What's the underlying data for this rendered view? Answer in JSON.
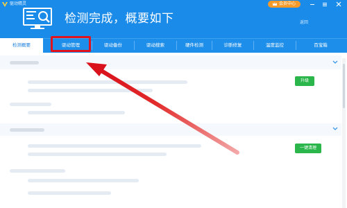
{
  "titlebar": {
    "app_name": "驱动精灵",
    "vip_label": "会员中心"
  },
  "header": {
    "title": "检测完成，概要如下",
    "small_text": "返回"
  },
  "tabs": [
    {
      "label": "检测概要"
    },
    {
      "label": "驱动管理"
    },
    {
      "label": "驱动备份"
    },
    {
      "label": "驱动搜索"
    },
    {
      "label": "硬件检测"
    },
    {
      "label": "诊断修复"
    },
    {
      "label": "温度监控"
    },
    {
      "label": "百宝箱"
    }
  ],
  "content": {
    "upgrade_button": "升级",
    "clean_button": "一键清理"
  },
  "colors": {
    "brand": "#1a8be9",
    "highlight": "#e3131d",
    "action_green": "#2ab64a",
    "vip_orange": "#f49a2a"
  }
}
